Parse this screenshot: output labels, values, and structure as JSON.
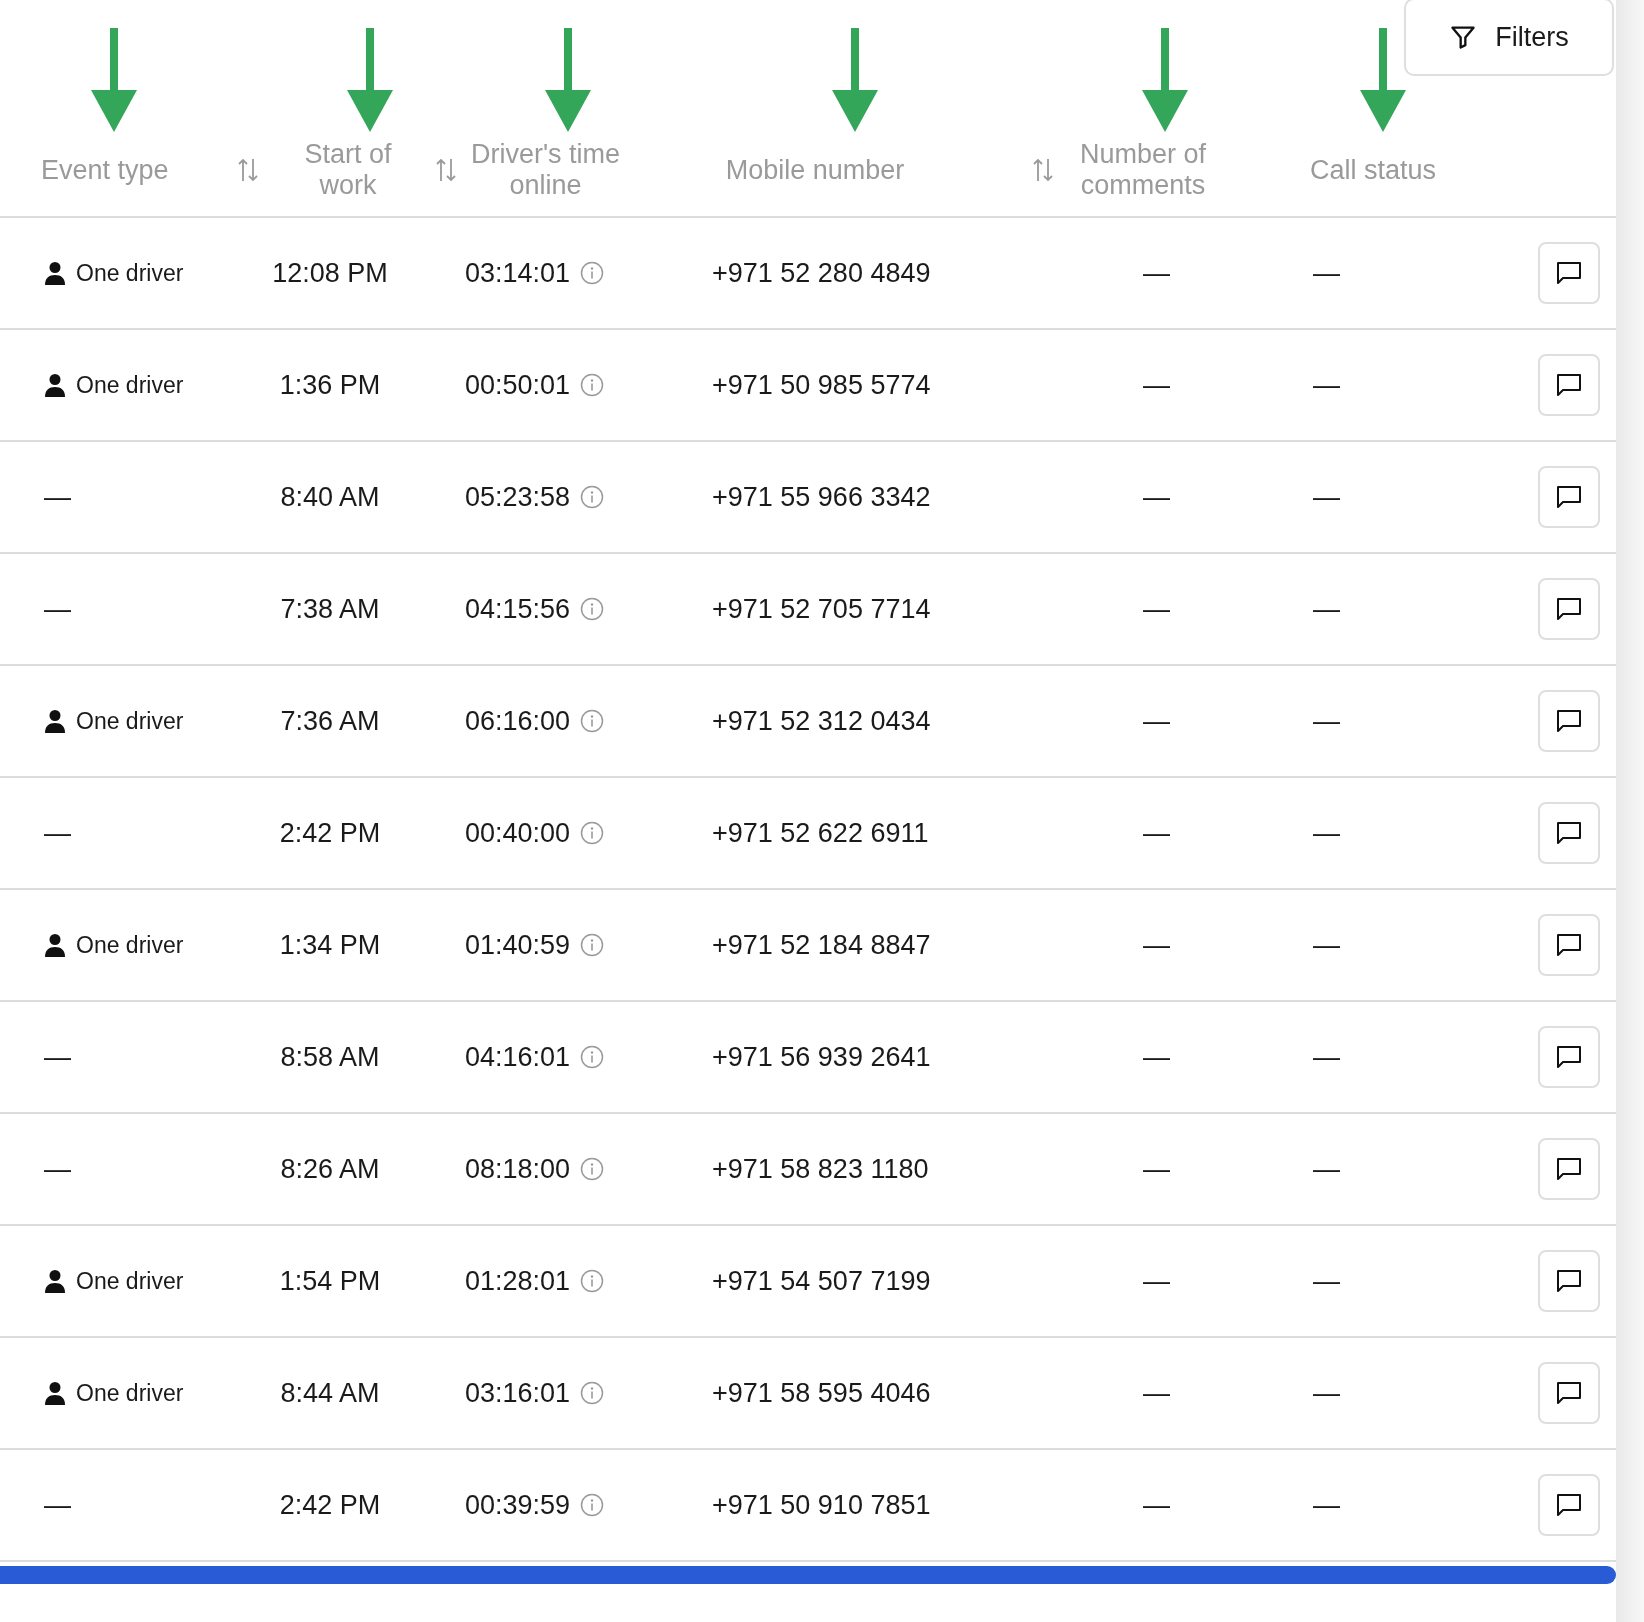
{
  "filters_button": {
    "label": "Filters"
  },
  "columns": [
    {
      "label": "Event type",
      "sortable": false,
      "annotated": true
    },
    {
      "label": "Start of work",
      "sortable": true,
      "annotated": true
    },
    {
      "label": "Driver's time online",
      "sortable": true,
      "annotated": true
    },
    {
      "label": "Mobile number",
      "sortable": false,
      "annotated": true
    },
    {
      "label": "Number of comments",
      "sortable": true,
      "annotated": true
    },
    {
      "label": "Call status",
      "sortable": false,
      "annotated": true
    }
  ],
  "rows": [
    {
      "event_type": "One driver",
      "person_icon": true,
      "start": "12:08 PM",
      "time_online": "03:14:01",
      "mobile": "+971 52 280 4849",
      "comments": "—",
      "call_status": "—"
    },
    {
      "event_type": "One driver",
      "person_icon": true,
      "start": "1:36 PM",
      "time_online": "00:50:01",
      "mobile": "+971 50 985 5774",
      "comments": "—",
      "call_status": "—"
    },
    {
      "event_type": "—",
      "person_icon": false,
      "start": "8:40 AM",
      "time_online": "05:23:58",
      "mobile": "+971 55 966 3342",
      "comments": "—",
      "call_status": "—"
    },
    {
      "event_type": "—",
      "person_icon": false,
      "start": "7:38 AM",
      "time_online": "04:15:56",
      "mobile": "+971 52 705 7714",
      "comments": "—",
      "call_status": "—"
    },
    {
      "event_type": "One driver",
      "person_icon": true,
      "start": "7:36 AM",
      "time_online": "06:16:00",
      "mobile": "+971 52 312 0434",
      "comments": "—",
      "call_status": "—"
    },
    {
      "event_type": "—",
      "person_icon": false,
      "start": "2:42 PM",
      "time_online": "00:40:00",
      "mobile": "+971 52 622 6911",
      "comments": "—",
      "call_status": "—"
    },
    {
      "event_type": "One driver",
      "person_icon": true,
      "start": "1:34 PM",
      "time_online": "01:40:59",
      "mobile": "+971 52 184 8847",
      "comments": "—",
      "call_status": "—"
    },
    {
      "event_type": "—",
      "person_icon": false,
      "start": "8:58 AM",
      "time_online": "04:16:01",
      "mobile": "+971 56 939 2641",
      "comments": "—",
      "call_status": "—"
    },
    {
      "event_type": "—",
      "person_icon": false,
      "start": "8:26 AM",
      "time_online": "08:18:00",
      "mobile": "+971 58 823 1180",
      "comments": "—",
      "call_status": "—"
    },
    {
      "event_type": "One driver",
      "person_icon": true,
      "start": "1:54 PM",
      "time_online": "01:28:01",
      "mobile": "+971 54 507 7199",
      "comments": "—",
      "call_status": "—"
    },
    {
      "event_type": "One driver",
      "person_icon": true,
      "start": "8:44 AM",
      "time_online": "03:16:01",
      "mobile": "+971 58 595 4046",
      "comments": "—",
      "call_status": "—"
    },
    {
      "event_type": "—",
      "person_icon": false,
      "start": "2:42 PM",
      "time_online": "00:39:59",
      "mobile": "+971 50 910 7851",
      "comments": "—",
      "call_status": "—"
    }
  ]
}
